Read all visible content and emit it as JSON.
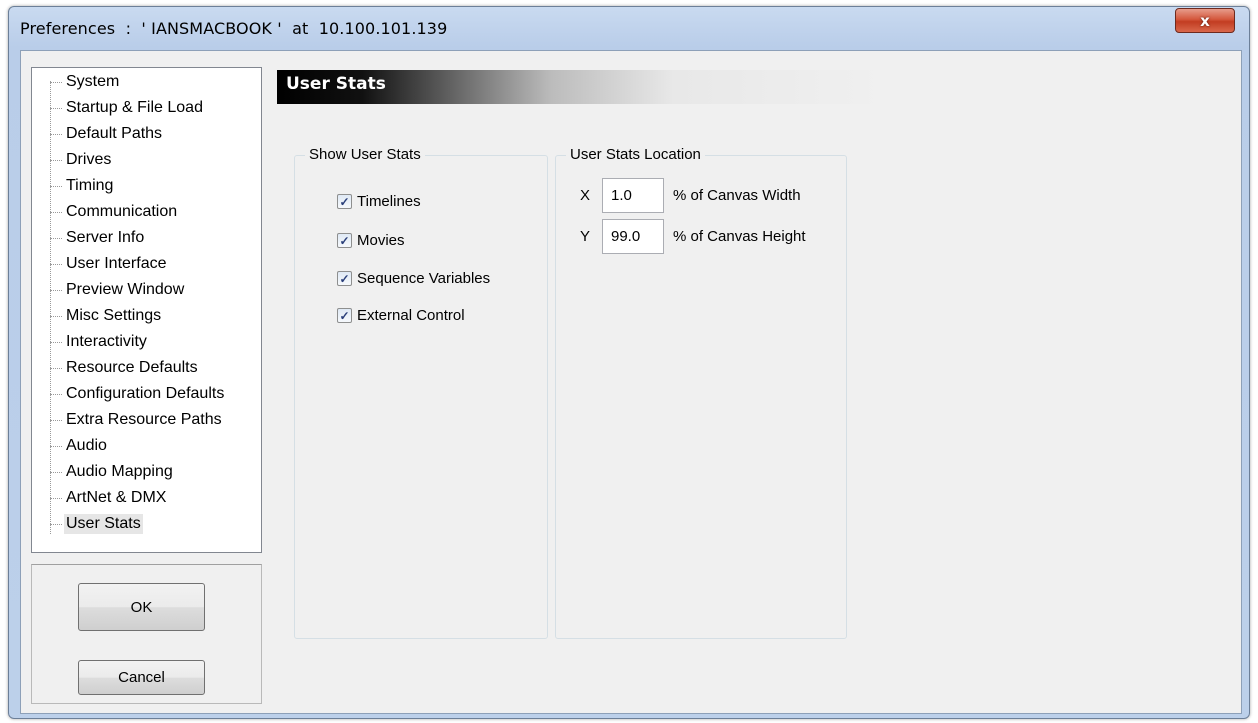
{
  "window": {
    "title": "Preferences  :  ' IANSMACBOOK '  at  10.100.101.139",
    "close_glyph": "x"
  },
  "sidebar": {
    "items": [
      {
        "label": "System"
      },
      {
        "label": "Startup & File Load"
      },
      {
        "label": "Default Paths"
      },
      {
        "label": "Drives"
      },
      {
        "label": "Timing"
      },
      {
        "label": "Communication"
      },
      {
        "label": "Server Info"
      },
      {
        "label": "User Interface"
      },
      {
        "label": "Preview Window"
      },
      {
        "label": "Misc Settings"
      },
      {
        "label": "Interactivity"
      },
      {
        "label": "Resource Defaults"
      },
      {
        "label": "Configuration Defaults"
      },
      {
        "label": "Extra Resource Paths"
      },
      {
        "label": "Audio"
      },
      {
        "label": "Audio Mapping"
      },
      {
        "label": "ArtNet & DMX"
      },
      {
        "label": "User Stats"
      }
    ],
    "selected": "User Stats"
  },
  "buttons": {
    "ok": "OK",
    "cancel": "Cancel"
  },
  "panel": {
    "title": "User Stats",
    "show_group": {
      "title": "Show User Stats",
      "options": [
        {
          "label": "Timelines",
          "checked": true
        },
        {
          "label": "Movies",
          "checked": true
        },
        {
          "label": "Sequence Variables",
          "checked": true
        },
        {
          "label": "External Control",
          "checked": true
        }
      ]
    },
    "location_group": {
      "title": "User Stats Location",
      "x": {
        "axis": "X",
        "value": "1.0",
        "unit": "% of Canvas Width"
      },
      "y": {
        "axis": "Y",
        "value": "99.0",
        "unit": "% of Canvas Height"
      }
    }
  },
  "colors": {
    "title_bar": "#b9cde9",
    "close_button": "#c23d22",
    "checkmark": "#2a3f7a"
  }
}
